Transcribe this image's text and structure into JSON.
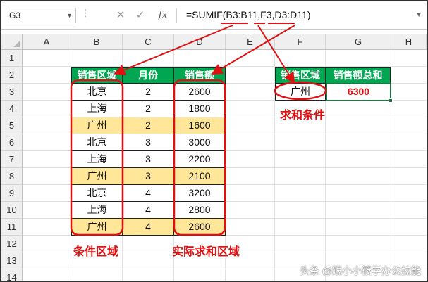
{
  "formula_bar": {
    "name_box": "G3",
    "formula": "=SUMIF(B3:B11,F3,D3:D11)",
    "fx_label": "fx",
    "cancel_icon": "✕",
    "enter_icon": "✓"
  },
  "columns": [
    "A",
    "B",
    "C",
    "D",
    "E",
    "F",
    "G",
    "H"
  ],
  "rows": [
    "1",
    "2",
    "3",
    "4",
    "5",
    "6",
    "7",
    "8",
    "9",
    "10",
    "11",
    "12",
    "13",
    "14"
  ],
  "table": {
    "headers": [
      "销售区域",
      "月份",
      "销售额"
    ],
    "rows": [
      {
        "region": "北京",
        "month": "2",
        "sales": "2600",
        "highlight": false
      },
      {
        "region": "上海",
        "month": "2",
        "sales": "1800",
        "highlight": false
      },
      {
        "region": "广州",
        "month": "2",
        "sales": "1600",
        "highlight": true
      },
      {
        "region": "北京",
        "month": "3",
        "sales": "3000",
        "highlight": false
      },
      {
        "region": "上海",
        "month": "3",
        "sales": "2200",
        "highlight": false
      },
      {
        "region": "广州",
        "month": "3",
        "sales": "2100",
        "highlight": true
      },
      {
        "region": "北京",
        "month": "4",
        "sales": "3200",
        "highlight": false
      },
      {
        "region": "上海",
        "month": "4",
        "sales": "2800",
        "highlight": false
      },
      {
        "region": "广州",
        "month": "4",
        "sales": "2600",
        "highlight": true
      }
    ]
  },
  "result_table": {
    "headers": [
      "销售区域",
      "销售额总和"
    ],
    "region": "广州",
    "total": "6300"
  },
  "annotations": {
    "criteria": "求和条件",
    "range": "条件区域",
    "sum_range": "实际求和区域"
  },
  "watermark": "头条 @跟小小筱学办公技能",
  "colors": {
    "header_green": "#00a651",
    "highlight_yellow": "#ffe699",
    "annotation_red": "#e01010",
    "selection_green": "#217346"
  }
}
